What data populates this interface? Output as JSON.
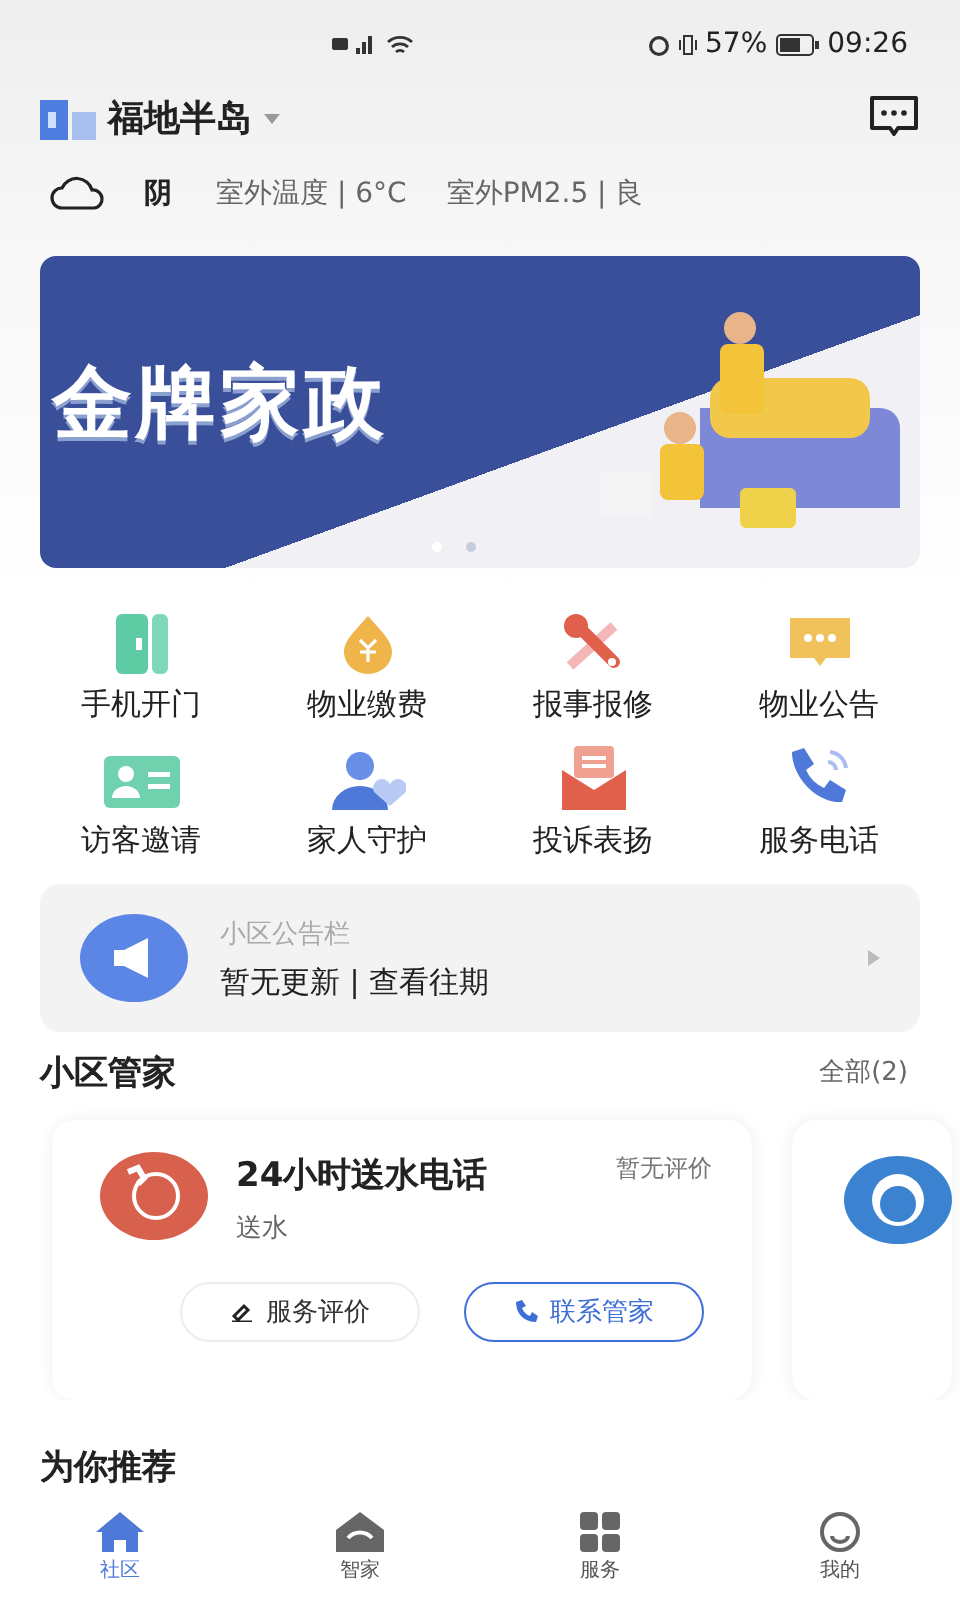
{
  "status_bar": {
    "time": "09:26",
    "battery": "57%"
  },
  "header": {
    "community": "福地半岛"
  },
  "weather": {
    "condition": "阴",
    "temperature": "室外温度 | 6°C",
    "pm25": "室外PM2.5 | 良"
  },
  "banner": {
    "title": "金牌家政",
    "dots": [
      {
        "selected": true
      },
      {
        "selected": false
      }
    ]
  },
  "services": [
    {
      "label": "手机开门",
      "kind": "door"
    },
    {
      "label": "物业缴费",
      "kind": "pay"
    },
    {
      "label": "报事报修",
      "kind": "repair"
    },
    {
      "label": "物业公告",
      "kind": "notice"
    },
    {
      "label": "访客邀请",
      "kind": "visitor"
    },
    {
      "label": "家人守护",
      "kind": "family"
    },
    {
      "label": "投诉表扬",
      "kind": "mail"
    },
    {
      "label": "服务电话",
      "kind": "phone"
    }
  ],
  "notice_board": {
    "title": "小区公告栏",
    "text": "暂无更新 | 查看往期"
  },
  "butler_section": {
    "title": "小区管家",
    "all_link": "全部(2)"
  },
  "butlers": [
    {
      "kind": "full",
      "name": "24小时送水电话",
      "category": "送水",
      "rating": "暂无评价",
      "actions": [
        "服务评价",
        "联系管家"
      ]
    },
    {
      "kind": "partial"
    }
  ],
  "recommend": {
    "title": "为你推荐"
  },
  "tab_bar": [
    {
      "label": "社区",
      "selected": true,
      "kind": "home"
    },
    {
      "label": "智家",
      "selected": false,
      "kind": "smart"
    },
    {
      "label": "服务",
      "selected": false,
      "kind": "grid"
    },
    {
      "label": "我的",
      "selected": false,
      "kind": "user"
    }
  ]
}
